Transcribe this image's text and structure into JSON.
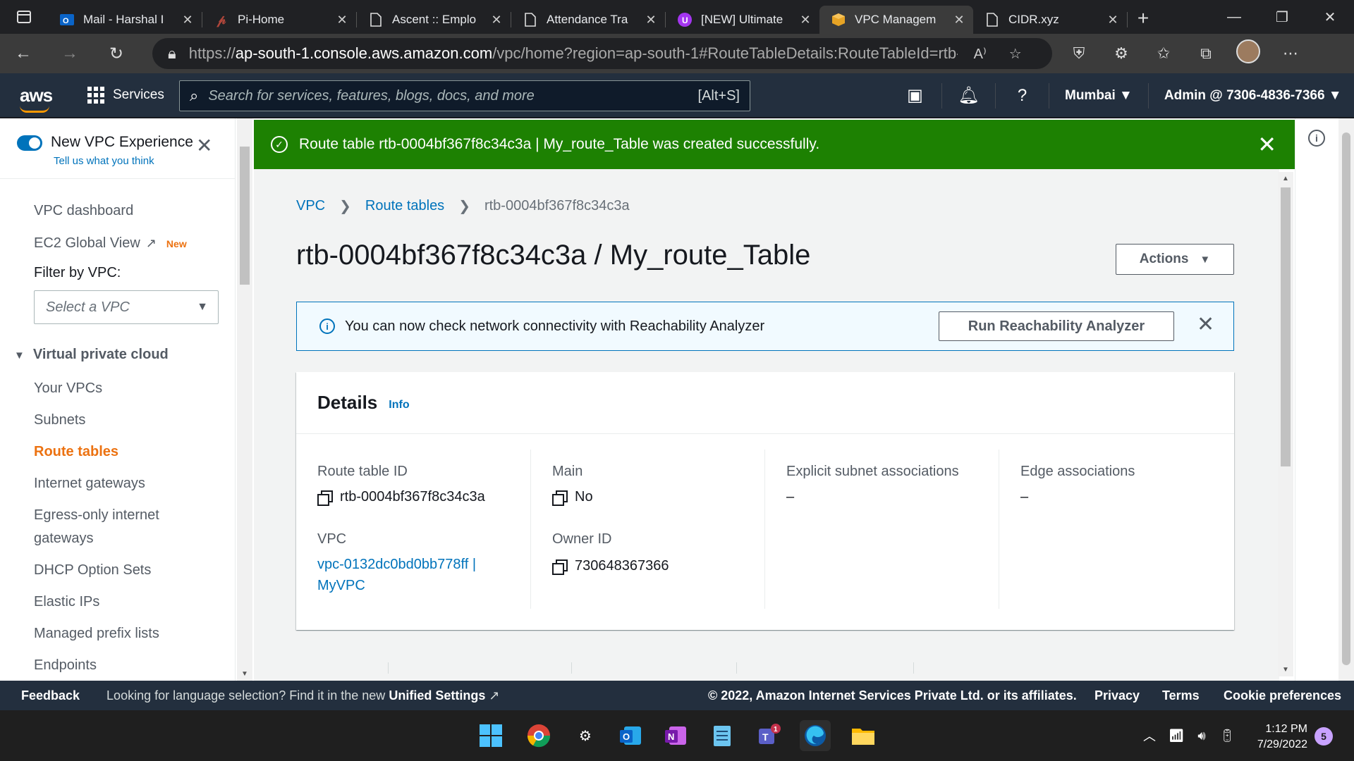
{
  "browser": {
    "tabs": [
      {
        "title": "Mail - Harshal I",
        "icon": "outlook-icon"
      },
      {
        "title": "Pi-Home",
        "icon": "pi-icon"
      },
      {
        "title": "Ascent :: Emplo",
        "icon": "page-icon"
      },
      {
        "title": "Attendance Tra",
        "icon": "page-icon"
      },
      {
        "title": "[NEW] Ultimate",
        "icon": "udemy-icon"
      },
      {
        "title": "VPC Managem",
        "icon": "aws-box-icon"
      },
      {
        "title": "CIDR.xyz",
        "icon": "page-icon"
      }
    ],
    "url_prefix": "https://",
    "url_host": "ap-south-1.console.aws.amazon.com",
    "url_path": "/vpc/home?region=ap-south-1#RouteTableDetails:RouteTableId=rtb-00..."
  },
  "aws_nav": {
    "logo": "aws",
    "services_label": "Services",
    "search_placeholder": "Search for services, features, blogs, docs, and more",
    "search_hint": "[Alt+S]",
    "region": "Mumbai",
    "account": "Admin @ 7306-4836-7366"
  },
  "sidebar": {
    "new_experience_label": "New VPC Experience",
    "new_experience_sub": "Tell us what you think",
    "items_top": [
      {
        "label": "VPC dashboard"
      },
      {
        "label": "EC2 Global View",
        "badge": "New"
      }
    ],
    "filter_label": "Filter by VPC:",
    "filter_placeholder": "Select a VPC",
    "section_title": "Virtual private cloud",
    "section_items": [
      "Your VPCs",
      "Subnets",
      "Route tables",
      "Internet gateways",
      "Egress-only internet",
      "gateways",
      "DHCP Option Sets",
      "Elastic IPs",
      "Managed prefix lists",
      "Endpoints"
    ],
    "active_item": "Route tables"
  },
  "flash": {
    "message": "Route table rtb-0004bf367f8c34c3a | My_route_Table was created successfully."
  },
  "breadcrumb": [
    "VPC",
    "Route tables",
    "rtb-0004bf367f8c34c3a"
  ],
  "page_title": "rtb-0004bf367f8c34c3a / My_route_Table",
  "actions_label": "Actions",
  "info_banner": {
    "message": "You can now check network connectivity with Reachability Analyzer",
    "button": "Run Reachability Analyzer"
  },
  "details": {
    "title": "Details",
    "info_link": "Info",
    "route_table_id_label": "Route table ID",
    "route_table_id": "rtb-0004bf367f8c34c3a",
    "vpc_label": "VPC",
    "vpc_value_line1": "vpc-0132dc0bd0bb778ff |",
    "vpc_value_line2": "MyVPC",
    "main_label": "Main",
    "main_value": "No",
    "owner_label": "Owner ID",
    "owner_value": "730648367366",
    "explicit_label": "Explicit subnet associations",
    "explicit_value": "–",
    "edge_label": "Edge associations",
    "edge_value": "–"
  },
  "footer": {
    "feedback": "Feedback",
    "message": "Looking for language selection? Find it in the new",
    "message_link": "Unified Settings",
    "copyright": "© 2022, Amazon Internet Services Private Ltd. or its affiliates.",
    "privacy": "Privacy",
    "terms": "Terms",
    "cookies": "Cookie preferences"
  },
  "taskbar": {
    "time": "1:12 PM",
    "date": "7/29/2022",
    "notification_count": "5",
    "teams_badge": "1"
  },
  "colors": {
    "aws_nav_bg": "#232f3e",
    "success_green": "#1d8102",
    "link_blue": "#0073bb",
    "active_orange": "#ec7211"
  }
}
